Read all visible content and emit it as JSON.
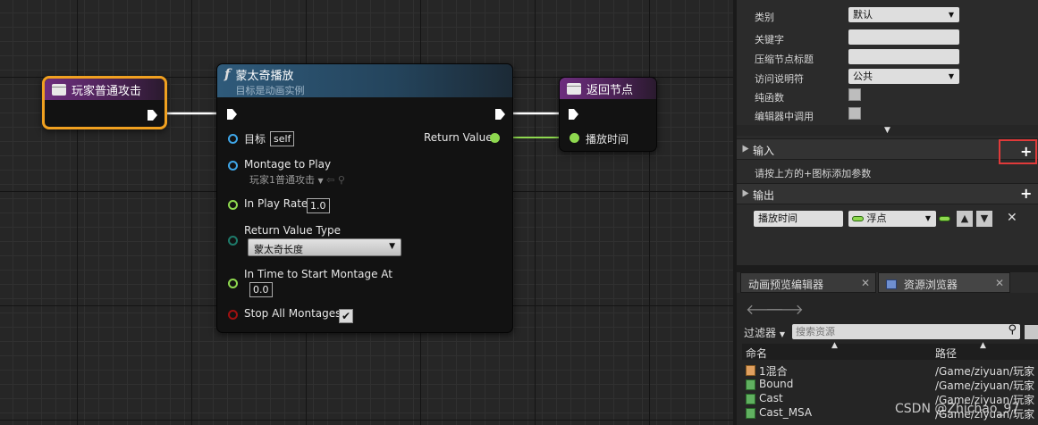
{
  "graph": {
    "event_node": {
      "title": "玩家普通攻击"
    },
    "montage_node": {
      "title": "蒙太奇播放",
      "subtitle": "目标是动画实例",
      "func_glyph": "f",
      "pins": {
        "target_label": "目标",
        "target_value": "self",
        "montage_label": "Montage to Play",
        "montage_value": "玩家1普通攻击",
        "rate_label": "In Play Rate",
        "rate_value": "1.0",
        "rvt_label": "Return Value Type",
        "rvt_value": "蒙太奇长度",
        "start_label": "In Time to Start Montage At",
        "start_value": "0.0",
        "stop_label": "Stop All Montages",
        "return_label": "Return Value"
      }
    },
    "return_node": {
      "title": "返回节点",
      "pin_label": "播放时间"
    }
  },
  "details": {
    "rows": [
      {
        "label": "类别",
        "value": "默认",
        "kind": "dropdown"
      },
      {
        "label": "关键字",
        "value": "",
        "kind": "input"
      },
      {
        "label": "压缩节点标题",
        "value": "",
        "kind": "input"
      },
      {
        "label": "访问说明符",
        "value": "公共",
        "kind": "dropdown"
      },
      {
        "label": "纯函数",
        "kind": "checkbox"
      },
      {
        "label": "编辑器中调用",
        "kind": "checkbox"
      }
    ],
    "inputs_title": "输入",
    "inputs_hint": "请按上方的+图标添加参数",
    "outputs_title": "输出",
    "output_param": {
      "name": "播放时间",
      "type": "浮点"
    }
  },
  "tabs": [
    {
      "label": "动画预览编辑器"
    },
    {
      "label": "资源浏览器"
    }
  ],
  "browser": {
    "filter_label": "过滤器",
    "search_placeholder": "搜索资源",
    "col_name": "命名",
    "col_path": "路径",
    "rows": [
      {
        "name": "1混合",
        "path": "/Game/ziyuan/玩家"
      },
      {
        "name": "Bound",
        "path": "/Game/ziyuan/玩家"
      },
      {
        "name": "Cast",
        "path": "/Game/ziyuan/玩家"
      },
      {
        "name": "Cast_MSA",
        "path": "/Game/ziyuan/玩家"
      }
    ]
  },
  "watermark": "CSDN @Zhichao_97",
  "colors": {
    "event_border": "#f0a020",
    "exec": "#ffffff",
    "float_pin": "#8ed84f",
    "object_pin": "#3fa6e8",
    "bool_pin": "#a01010",
    "highlight": "#e03a3a"
  }
}
